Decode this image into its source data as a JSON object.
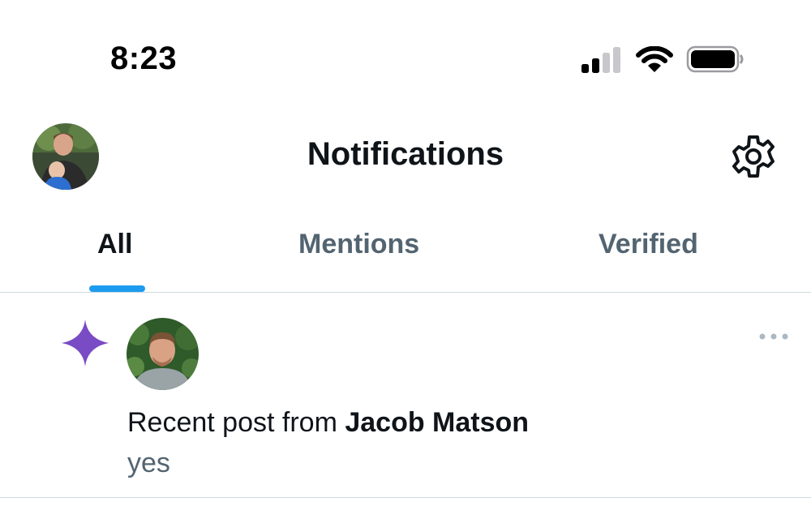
{
  "status_bar": {
    "time": "8:23",
    "icons": [
      "cellular-signal-icon",
      "wifi-icon",
      "battery-icon"
    ]
  },
  "header": {
    "title": "Notifications",
    "avatar": "profile-avatar",
    "settings_icon": "gear-icon"
  },
  "tabs": [
    {
      "label": "All",
      "active": true
    },
    {
      "label": "Mentions",
      "active": false
    },
    {
      "label": "Verified",
      "active": false
    }
  ],
  "notifications": [
    {
      "icon": "sparkle-icon",
      "prefix": "Recent post from ",
      "author": "Jacob Matson",
      "preview": "yes",
      "more_icon": "more-dots-icon"
    }
  ],
  "colors": {
    "accent": "#1d9bf0",
    "sparkle": "#794bc4",
    "text_primary": "#0f1419",
    "text_secondary": "#536471",
    "divider": "#cfd9de"
  }
}
